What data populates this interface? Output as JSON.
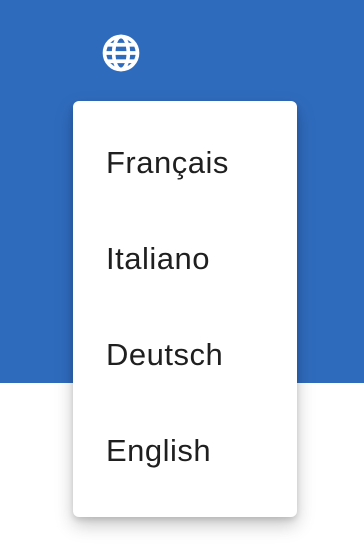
{
  "language_menu": {
    "trigger_icon": "globe-icon",
    "items": [
      {
        "label": "Français"
      },
      {
        "label": "Italiano"
      },
      {
        "label": "Deutsch"
      },
      {
        "label": "English"
      }
    ]
  },
  "colors": {
    "header_background": "#2f6bbd",
    "menu_background": "#ffffff",
    "menu_text": "#1f1f1f",
    "icon": "#ffffff"
  }
}
